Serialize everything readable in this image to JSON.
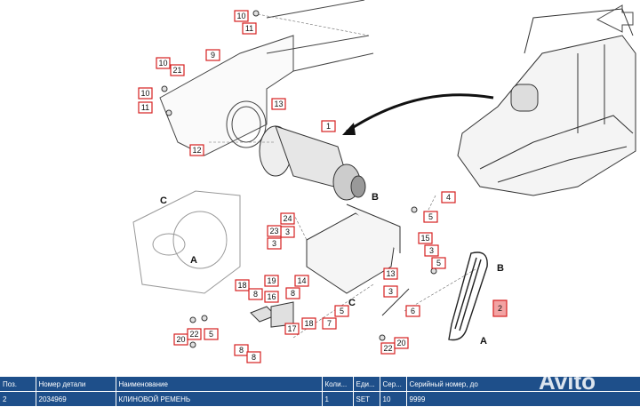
{
  "diagram": {
    "callouts": [
      "10",
      "11",
      "9",
      "10",
      "21",
      "10",
      "11",
      "13",
      "12",
      "1",
      "4",
      "5",
      "24",
      "3",
      "23",
      "3",
      "15",
      "3",
      "5",
      "14",
      "18",
      "8",
      "19",
      "16",
      "8",
      "18",
      "7",
      "5",
      "13",
      "3",
      "20",
      "22",
      "5",
      "22",
      "20",
      "8",
      "2",
      "6",
      "17",
      "8"
    ],
    "view_letters": [
      "C",
      "A",
      "B",
      "A",
      "B",
      "C"
    ],
    "highlight_callout": "2"
  },
  "table": {
    "headers": [
      "Поз.",
      "Номер детали",
      "Наименование",
      "Коли...",
      "Еди...",
      "Сер...",
      "Серийный номер, до"
    ],
    "rows": [
      [
        "2",
        "2034969",
        "КЛИНОВОЙ РЕМЕНЬ",
        "1",
        "SET",
        "10",
        "9999"
      ]
    ]
  },
  "watermark": "Avito",
  "colors": {
    "table_header": "#1e4f8a",
    "callout_border": "#d62020",
    "callout_highlight": "#f2a3a3"
  }
}
